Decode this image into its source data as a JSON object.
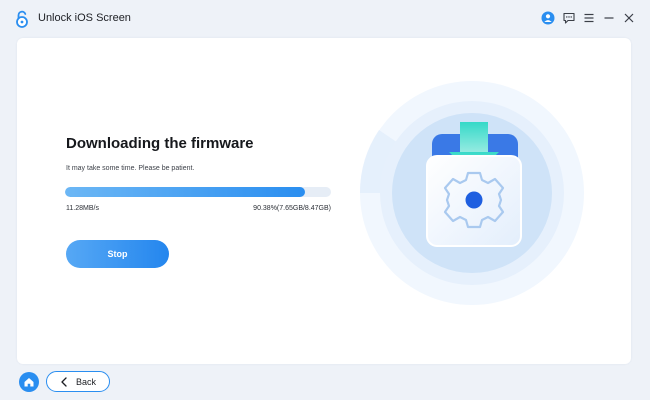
{
  "app": {
    "title": "Unlock iOS Screen",
    "logo_icon": "open-padlock-icon",
    "accent_color": "#2a8ef0"
  },
  "titlebar": {
    "icons": [
      "user-account-icon",
      "feedback-icon",
      "menu-icon",
      "minimize-icon",
      "close-icon"
    ]
  },
  "main": {
    "heading": "Downloading the firmware",
    "subtitle": "It may take some time. Please be patient.",
    "progress": {
      "fraction": 0.9038,
      "speed_text": "11.28MB/s",
      "percent_text": "90.38%(7.65GB/8.47GB)"
    },
    "stop_label": "Stop",
    "illustration_icon": "firmware-download-gear-icon"
  },
  "footer": {
    "home_icon": "home-icon",
    "back_icon": "chevron-left-icon",
    "back_label": "Back"
  }
}
